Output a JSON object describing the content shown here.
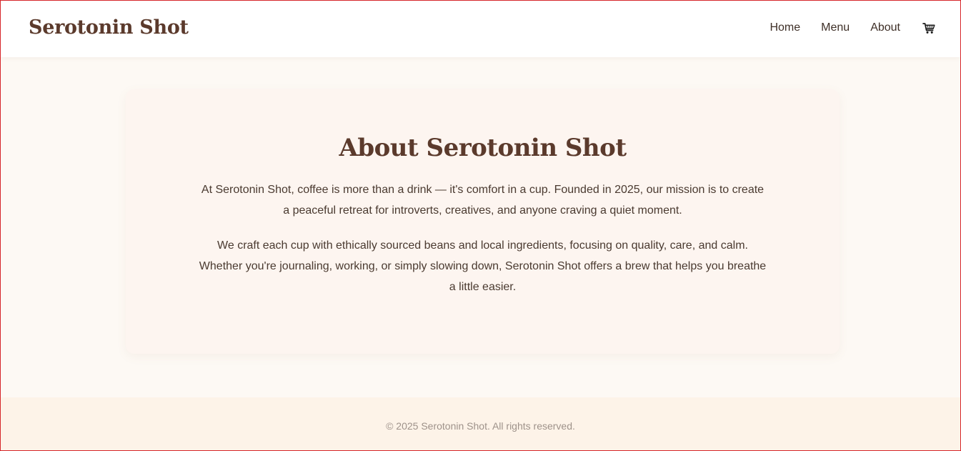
{
  "header": {
    "brand": "Serotonin Shot",
    "nav": {
      "home": "Home",
      "menu": "Menu",
      "about": "About",
      "cart_icon": "cart-icon"
    }
  },
  "about": {
    "title": "About Serotonin Shot",
    "paragraph_1": "At Serotonin Shot, coffee is more than a drink — it's comfort in a cup. Founded in 2025, our mission is to create a peaceful retreat for introverts, creatives, and anyone craving a quiet moment.",
    "paragraph_2": "We craft each cup with ethically sourced beans and local ingredients, focusing on quality, care, and calm. Whether you're journaling, working, or simply slowing down, Serotonin Shot offers a brew that helps you breathe a little easier."
  },
  "footer": {
    "copyright": "© 2025 Serotonin Shot. All rights reserved."
  },
  "colors": {
    "brand": "#5b3a2c",
    "page_background": "#fdf9f4",
    "card_background": "#fdf5f0",
    "footer_background": "#fdf3e8"
  }
}
